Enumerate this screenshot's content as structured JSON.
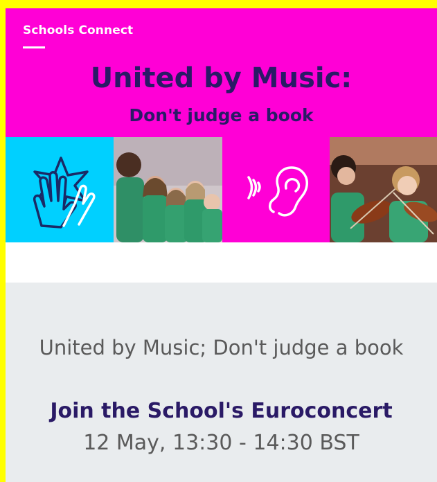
{
  "banner": {
    "brand": "Schools Connect",
    "title": "United by Music:",
    "subtitle": "Don't judge a book"
  },
  "event": {
    "title": "United by Music; Don't judge a book",
    "cta": "Join the School's Euroconcert",
    "time": "12 May, 13:30 - 14:30 BST"
  },
  "colors": {
    "frame": "#ffff00",
    "banner": "#ff00d6",
    "heading": "#2a1a66",
    "cyan_tile": "#00d0ff",
    "card": "#e9ecee",
    "body_text": "#5a5a5a"
  },
  "icons": [
    "high-five-star-icon",
    "ear-sound-icon"
  ]
}
